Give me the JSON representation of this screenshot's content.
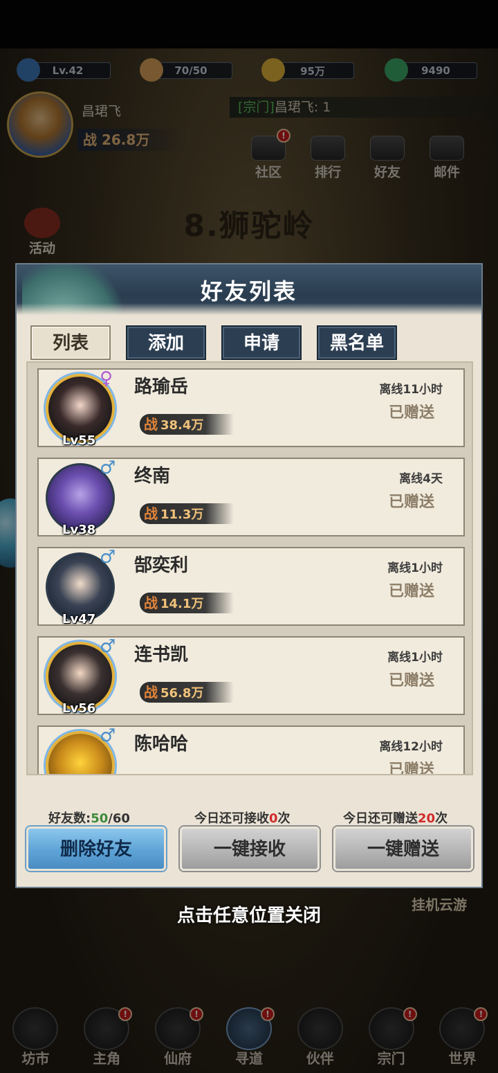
{
  "hud": {
    "level": "Lv.42",
    "stamina": "70/50",
    "coins": "95万",
    "jade": "9490",
    "player_name": "昌珺飞",
    "player_power_prefix": "战",
    "player_power": "26.8万",
    "sect_tag": "[宗门]",
    "sect_message": "昌珺飞: 1",
    "top_icons": [
      {
        "label": "社区",
        "badge": "!"
      },
      {
        "label": "排行",
        "badge": ""
      },
      {
        "label": "好友",
        "badge": ""
      },
      {
        "label": "邮件",
        "badge": ""
      }
    ],
    "stage_title": "8.狮驼岭",
    "activity_label": "活动",
    "idle_label": "挂机云游"
  },
  "modal": {
    "title": "好友列表",
    "tabs": [
      "列表",
      "添加",
      "申请",
      "黑名单"
    ],
    "active_tab": 0,
    "friends": [
      {
        "name": "路瑜岳",
        "gender": "♀",
        "level": "Lv55",
        "power_prefix": "战",
        "power": "38.4万",
        "offline": "离线11小时",
        "status": "已赠送"
      },
      {
        "name": "终南",
        "gender": "♂",
        "level": "Lv38",
        "power_prefix": "战",
        "power": "11.3万",
        "offline": "离线4天",
        "status": "已赠送"
      },
      {
        "name": "郜奕利",
        "gender": "♂",
        "level": "Lv47",
        "power_prefix": "战",
        "power": "14.1万",
        "offline": "离线1小时",
        "status": "已赠送"
      },
      {
        "name": "连书凯",
        "gender": "♂",
        "level": "Lv56",
        "power_prefix": "战",
        "power": "56.8万",
        "offline": "离线1小时",
        "status": "已赠送"
      },
      {
        "name": "陈哈哈",
        "gender": "♂",
        "level": "",
        "power_prefix": "",
        "power": "",
        "offline": "离线12小时",
        "status": "已赠送"
      }
    ],
    "friend_count_label": "好友数:",
    "friend_count": "50",
    "friend_max": "/60",
    "receive_prefix": "今日还可接收",
    "receive_count": "0",
    "receive_suffix": "次",
    "gift_prefix": "今日还可赠送",
    "gift_count": "20",
    "gift_suffix": "次",
    "delete_label": "删除好友",
    "receive_all_label": "一键接收",
    "gift_all_label": "一键赠送"
  },
  "close_hint": "点击任意位置关闭",
  "bottom_nav": [
    {
      "label": "坊市",
      "badge": ""
    },
    {
      "label": "主角",
      "badge": "!"
    },
    {
      "label": "仙府",
      "badge": "!"
    },
    {
      "label": "寻道",
      "badge": "!"
    },
    {
      "label": "伙伴",
      "badge": ""
    },
    {
      "label": "宗门",
      "badge": "!"
    },
    {
      "label": "世界",
      "badge": "!"
    }
  ]
}
